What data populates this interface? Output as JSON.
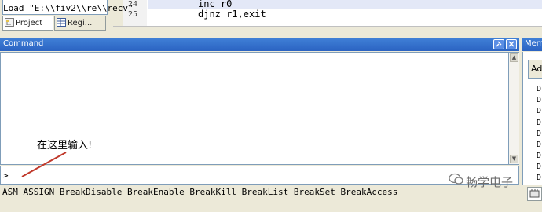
{
  "project_panel": {
    "tabs": [
      {
        "label": "Project",
        "icon": "project-tree-icon"
      },
      {
        "label": "Regi...",
        "icon": "register-grid-icon"
      }
    ]
  },
  "editor": {
    "lines": [
      {
        "num": "24",
        "code": "inc r0"
      },
      {
        "num": "25",
        "code": "djnz r1,exit"
      }
    ]
  },
  "command_window": {
    "title": "Command",
    "output_lines": [
      "Load \"E:\\\\fiv2\\\\re\\\\recv\""
    ],
    "prompt": ">",
    "input_value": "",
    "annotation": "在这里输入!",
    "help_text": "ASM ASSIGN BreakDisable BreakEnable BreakKill BreakList BreakSet BreakAccess"
  },
  "memory_window": {
    "title": "Memo",
    "address_label": "Ad",
    "rows": [
      "D",
      "D",
      "D",
      "D",
      "D",
      "D",
      "D",
      "D",
      "D",
      "D"
    ]
  },
  "watermark": {
    "text": "畅学电子"
  },
  "colors": {
    "title_bar": "#2b63c2",
    "annotation_arrow": "#c0392b"
  }
}
